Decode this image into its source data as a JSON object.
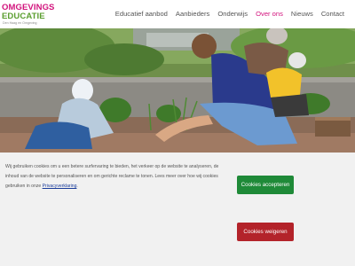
{
  "logo": {
    "line1": "OMGEVINGS",
    "line2": "EDUCATIE",
    "tagline": "Den Haag en Omgeving"
  },
  "nav": {
    "items": [
      {
        "label": "Educatief aanbod"
      },
      {
        "label": "Aanbieders"
      },
      {
        "label": "Onderwijs"
      },
      {
        "label": "Over ons",
        "active": true
      },
      {
        "label": "Nieuws"
      },
      {
        "label": "Contact"
      }
    ]
  },
  "hero": {
    "description": "children and an adult gardening in raised planters"
  },
  "cookie": {
    "text": "Wij gebruiken cookies om u een betere surfervaring te bieden, het verkeer op de website te analyseren, de inhoud van de website te personaliseren en om gerichte reclame te tonen. Lees meer over hoe wij cookies gebruiken in onze ",
    "link": "Privacyverklaring",
    "after_link": ".",
    "accept_label": "Cookies accepteren",
    "decline_label": "Cookies weigeren"
  },
  "colors": {
    "brand_pink": "#d2127c",
    "brand_green": "#5a9e2f",
    "accept": "#1f8a38",
    "decline": "#b3232a"
  }
}
